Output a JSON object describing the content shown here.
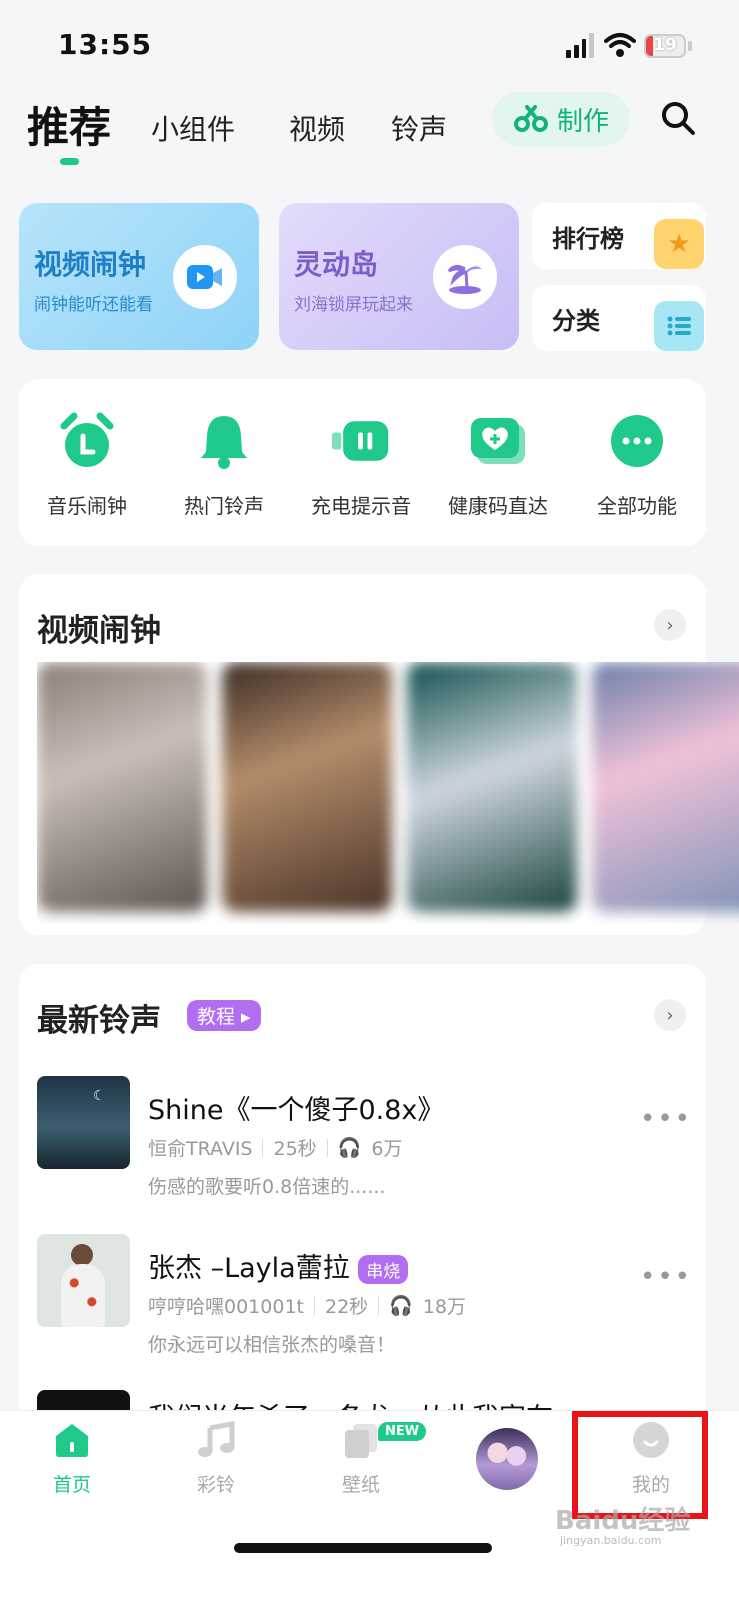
{
  "status_bar": {
    "time": "13:55",
    "battery": "19"
  },
  "top_nav": {
    "tabs": [
      "推荐",
      "小组件",
      "视频",
      "铃声"
    ],
    "make_label": "制作"
  },
  "banners": [
    {
      "title": "视频闹钟",
      "subtitle": "闹钟能听还能看",
      "icon": "video-play-icon"
    },
    {
      "title": "灵动岛",
      "subtitle": "刘海锁屏玩起来",
      "icon": "palm-island-icon"
    }
  ],
  "side_cards": [
    {
      "label": "排行榜",
      "icon": "star-icon"
    },
    {
      "label": "分类",
      "icon": "list-icon"
    }
  ],
  "quick_actions": [
    {
      "label": "音乐闹钟",
      "icon": "alarm-clock-icon"
    },
    {
      "label": "热门铃声",
      "icon": "bell-icon"
    },
    {
      "label": "充电提示音",
      "icon": "battery-charge-icon"
    },
    {
      "label": "健康码直达",
      "icon": "health-code-icon"
    },
    {
      "label": "全部功能",
      "icon": "more-dots-icon"
    }
  ],
  "video_alarm_section": {
    "title": "视频闹钟"
  },
  "ringtone_section": {
    "title": "最新铃声",
    "tutorial_tag": "教程",
    "items": [
      {
        "title": "Shine《一个傻子0.8x》",
        "author": "恒俞TRAVIS",
        "duration": "25秒",
        "plays": "6万",
        "desc": "伤感的歌要听0.8倍速的......"
      },
      {
        "title": "张杰 –Layla蕾拉",
        "tag": "串烧",
        "author": "哼哼哈嘿001001t",
        "duration": "22秒",
        "plays": "18万",
        "desc": "你永远可以相信张杰的嗓音！"
      },
      {
        "title": "我们当年杀了一条龙，从此我宣布……"
      }
    ]
  },
  "bottom_nav": {
    "items": [
      {
        "label": "首页",
        "active": true
      },
      {
        "label": "彩铃"
      },
      {
        "label": "壁纸",
        "badge": "NEW"
      },
      {
        "label": ""
      },
      {
        "label": "我的"
      }
    ]
  },
  "watermark": {
    "text": "Baidu经验",
    "url": "jingyan.baidu.com"
  },
  "colors": {
    "accent": "#1ec98a",
    "highlight": "#e8141a",
    "tag": "#b26ef0"
  }
}
